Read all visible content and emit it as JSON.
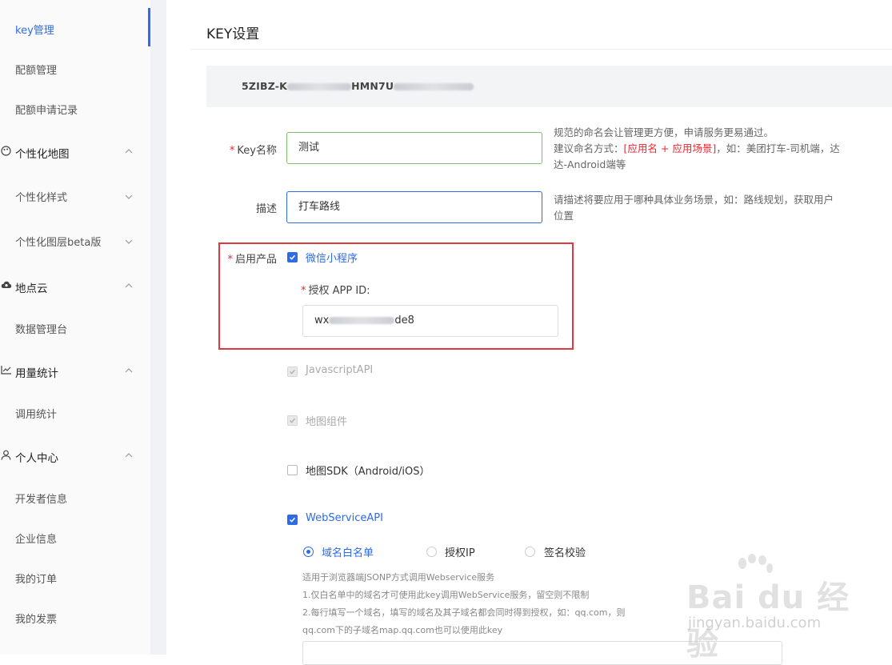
{
  "sidebar": {
    "key_mgmt": "key管理",
    "quota_mgmt": "配额管理",
    "quota_records": "配额申请记录",
    "group_custom_map": "个性化地图",
    "custom_style": "个性化样式",
    "custom_layer": "个性化图层beta版",
    "group_place_cloud": "地点云",
    "data_console": "数据管理台",
    "group_usage": "用量统计",
    "call_stats": "调用统计",
    "group_personal": "个人中心",
    "developer_info": "开发者信息",
    "company_info": "企业信息",
    "my_orders": "我的订单",
    "my_invoices": "我的发票"
  },
  "main": {
    "title": "KEY设置",
    "key_prefix": "5ZIBZ-K",
    "key_mid": "HMN7U"
  },
  "form": {
    "key_name_label": "Key名称",
    "key_name_value": "测试",
    "key_name_hint_1": "规范的命名会让管理更方便，申请服务更易通过。",
    "key_name_hint_2a": "建议命名方式：",
    "key_name_hint_2b": "[应用名 + 应用场景]",
    "key_name_hint_2c": "，如：美团打车-司机端，达达-Android端等",
    "desc_label": "描述",
    "desc_value": "打车路线",
    "desc_hint": "请描述将要应用于哪种具体业务场景，如：路线规划，获取用户位置",
    "products_label": "启用产品",
    "wechat_mini": "微信小程序",
    "appid_label": "授权 APP ID:",
    "appid_prefix": "wx",
    "appid_suffix": "de8",
    "js_api": "JavascriptAPI",
    "map_component": "地图组件",
    "map_sdk": "地图SDK（Android/iOS）",
    "webservice_api": "WebServiceAPI",
    "radio_domain": "域名白名单",
    "radio_ip": "授权IP",
    "radio_sign": "签名校验",
    "note_1": "适用于浏览器端JSONP方式调用Webservice服务",
    "note_2": "1.仅白名单中的域名才可使用此key调用WebService服务，留空则不限制",
    "note_3": "2.每行填写一个域名，填写的域名及其子域名都会同时得到授权，如：qq.com，则",
    "note_4": "qq.com下的子域名map.qq.com也可以使用此key"
  },
  "watermark": {
    "brand": "Bai du 经验",
    "sub": "jingyan.baidu.com"
  },
  "colors": {
    "accent": "#2e6be6",
    "required": "#f5222d",
    "highlight_box": "#e0383e"
  }
}
